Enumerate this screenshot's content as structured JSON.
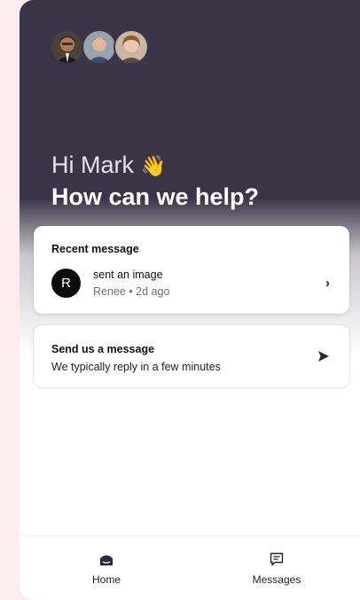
{
  "greeting": {
    "hi": "Hi Mark",
    "wave": "👋",
    "headline": "How can we help?"
  },
  "team_avatars": [
    "team-member-avatar-1",
    "team-member-avatar-2",
    "team-member-avatar-3"
  ],
  "recent": {
    "title": "Recent message",
    "avatar_initial": "R",
    "message": "sent an image",
    "meta": "Renee • 2d ago",
    "chevron": "›"
  },
  "send": {
    "title": "Send us a message",
    "subtitle": "We typically reply in a few minutes",
    "icon": "send-icon"
  },
  "nav": {
    "home_label": "Home",
    "messages_label": "Messages",
    "home_icon": "home-icon",
    "messages_icon": "messages-icon"
  },
  "colors": {
    "page_bg": "#fcecef",
    "hero_bg": "#3b3548",
    "card_bg": "#ffffff",
    "avatar_dark": "#0b0b0d"
  }
}
